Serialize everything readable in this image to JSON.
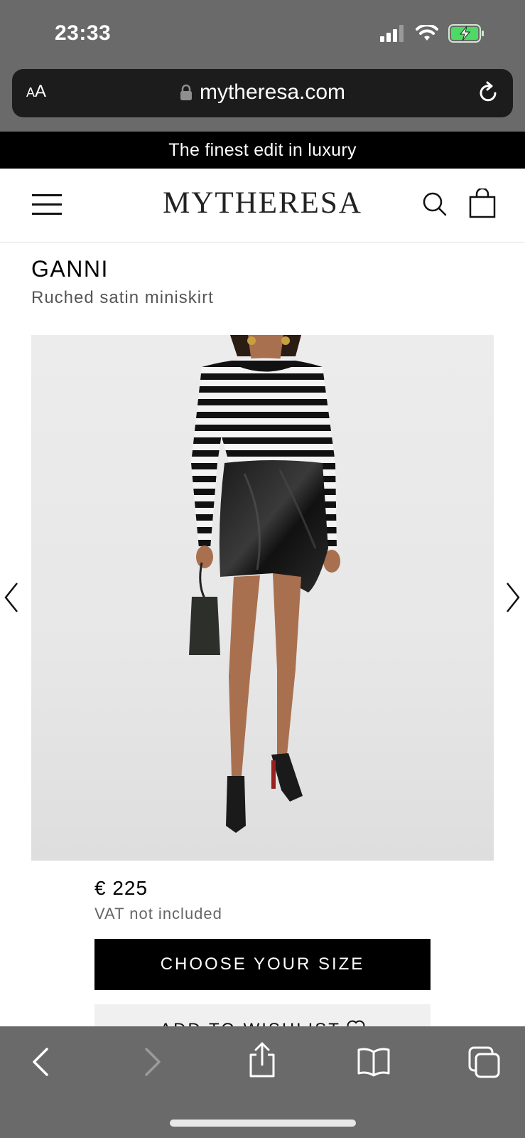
{
  "status_bar": {
    "time": "23:33"
  },
  "browser": {
    "aa_label_small": "A",
    "aa_label_large": "A",
    "url": "mytheresa.com"
  },
  "promo": {
    "text": "The finest edit in luxury"
  },
  "header": {
    "logo": "MYTHERESA"
  },
  "product": {
    "brand": "GANNI",
    "name": "Ruched satin miniskirt",
    "price": "€ 225",
    "vat_note": "VAT not included"
  },
  "actions": {
    "choose_size": "CHOOSE YOUR SIZE",
    "add_to_wishlist": "ADD TO WISHLIST"
  },
  "icons": {
    "menu": "menu-icon",
    "search": "search-icon",
    "bag": "shopping-bag-icon",
    "prev": "chevron-left-icon",
    "next": "chevron-right-icon",
    "heart": "heart-icon"
  },
  "colors": {
    "promo_bg": "#000000",
    "cta_bg": "#000000",
    "browser_chrome": "#6a6a6a",
    "battery": "#4cd964"
  }
}
